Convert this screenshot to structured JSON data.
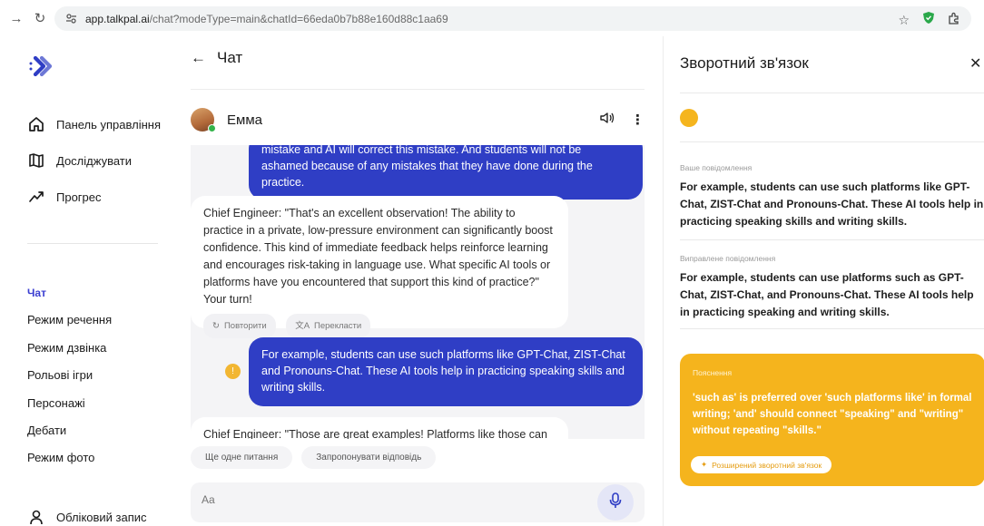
{
  "browser": {
    "url_host": "app.talkpal.ai",
    "url_rest": "/chat?modeType=main&chatId=66eda0b7b88e160d88c1aa69"
  },
  "sidebar": {
    "nav": [
      {
        "label": "Панель управління",
        "icon": "home-icon"
      },
      {
        "label": "Досліджувати",
        "icon": "map-icon"
      },
      {
        "label": "Прогрес",
        "icon": "trend-icon"
      }
    ],
    "modes": [
      "Чат",
      "Режим речення",
      "Режим дзвінка",
      "Рольові ігри",
      "Персонажі",
      "Дебати",
      "Режим фото"
    ],
    "account_label": "Обліковий запис"
  },
  "chat": {
    "title": "Чат",
    "contact_name": "Емма",
    "messages": {
      "user_partial": "mistake and AI will correct this mistake. And students will not be ashamed because of any mistakes that they have done during the practice.",
      "bot_1": "Chief Engineer: \"That's an excellent observation! The ability to practice in a private, low-pressure environment can significantly boost confidence. This kind of immediate feedback helps reinforce learning and encourages risk-taking in language use. What specific AI tools or platforms have you encountered that support this kind of practice?\" Your turn!",
      "repeat_label": "Повторити",
      "translate_label": "Перекласти",
      "user_2": "For example, students can use such platforms like GPT-Chat, ZIST-Chat and Pronouns-Chat. These AI tools help in practicing speaking skills and writing skills.",
      "bot_2_partial": "Chief Engineer: \"Those are great examples! Platforms like those can offer"
    },
    "suggestions": [
      "Ще одне питання",
      "Запропонувати відповідь"
    ],
    "input_placeholder": "Aa"
  },
  "feedback": {
    "title": "Зворотний зв'язок",
    "your_message_label": "Ваше повідомлення",
    "your_message": "For example, students can use such platforms like GPT-Chat, ZIST-Chat and Pronouns-Chat. These AI tools help in practicing speaking skills and writing skills.",
    "corrected_label": "Виправлене повідомлення",
    "corrected_message": "For example, students can use platforms such as GPT-Chat, ZIST-Chat, and Pronouns-Chat. These AI tools help in practicing speaking and writing skills.",
    "explanation_label": "Пояснення",
    "explanation": "'such as' is preferred over 'such platforms like' in formal writing; 'and' should connect \"speaking\" and \"writing\" without repeating \"skills.\"",
    "extended_button": "Розширений зворотний зв'язок"
  },
  "colors": {
    "accent_blue": "#2f3ec5",
    "feedback_yellow": "#f5b41d",
    "active_mode": "#3b3fd1"
  }
}
